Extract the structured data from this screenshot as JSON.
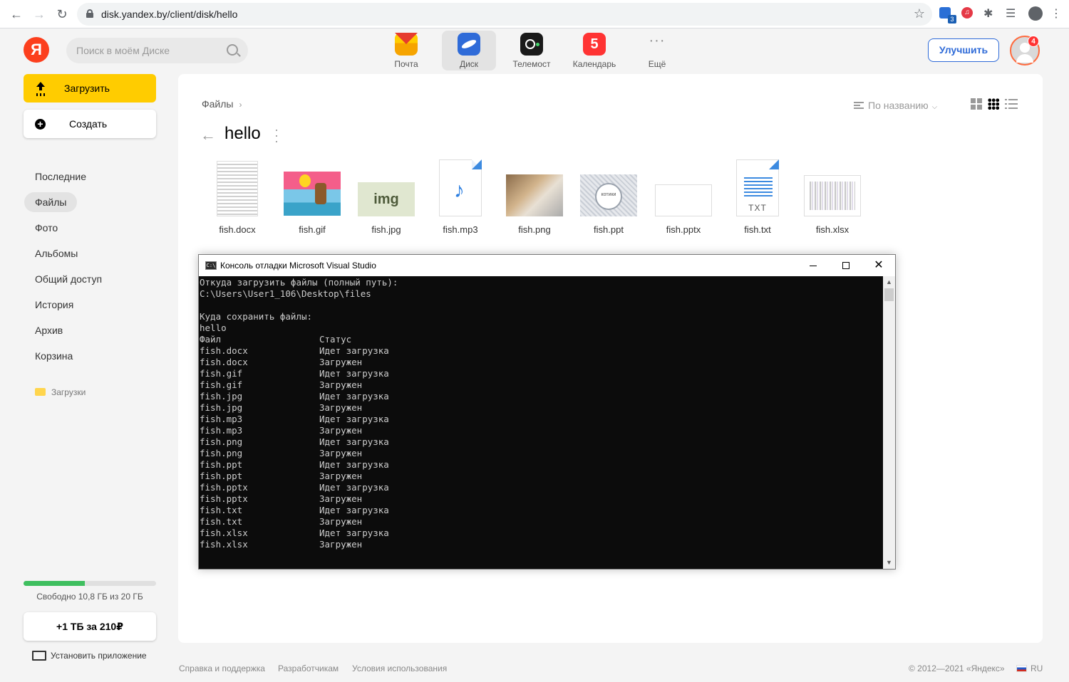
{
  "browser": {
    "url": "disk.yandex.by/client/disk/hello",
    "extension_badge": "3"
  },
  "header": {
    "logo": "Я",
    "search_placeholder": "Поиск в моём Диске",
    "apps": [
      {
        "label": "Почта",
        "icon": "mail-icon"
      },
      {
        "label": "Диск",
        "icon": "disk-icon",
        "active": true
      },
      {
        "label": "Телемост",
        "icon": "telemost-icon"
      },
      {
        "label": "Календарь",
        "icon": "calendar-icon",
        "day": "5"
      },
      {
        "label": "Ещё",
        "icon": "more-icon"
      }
    ],
    "upgrade_label": "Улучшить",
    "notification_count": "4"
  },
  "sidebar": {
    "upload_label": "Загрузить",
    "create_label": "Создать",
    "items": [
      {
        "label": "Последние"
      },
      {
        "label": "Файлы",
        "active": true
      },
      {
        "label": "Фото"
      },
      {
        "label": "Альбомы"
      },
      {
        "label": "Общий доступ"
      },
      {
        "label": "История"
      },
      {
        "label": "Архив"
      },
      {
        "label": "Корзина"
      }
    ],
    "folder_label": "Загрузки",
    "storage_text": "Свободно 10,8 ГБ из 20 ГБ",
    "storage_used_fraction": 0.46,
    "buy_label": "+1 ТБ за 210₽",
    "install_label": "Установить приложение"
  },
  "main": {
    "breadcrumb": "Файлы",
    "sort_label": "По названию",
    "folder_title": "hello",
    "files": [
      {
        "name": "fish.docx",
        "thumb": "docx"
      },
      {
        "name": "fish.gif",
        "thumb": "gif"
      },
      {
        "name": "fish.jpg",
        "thumb": "jpg",
        "thumb_text": "img"
      },
      {
        "name": "fish.mp3",
        "thumb": "mp3"
      },
      {
        "name": "fish.png",
        "thumb": "png"
      },
      {
        "name": "fish.ppt",
        "thumb": "ppt"
      },
      {
        "name": "fish.pptx",
        "thumb": "pptx"
      },
      {
        "name": "fish.txt",
        "thumb": "txt",
        "thumb_text": "TXT"
      },
      {
        "name": "fish.xlsx",
        "thumb": "xlsx"
      }
    ]
  },
  "console": {
    "icon_text": "C:\\",
    "title": "Консоль отладки Microsoft Visual Studio",
    "intro_lines": [
      "Откуда загрузить файлы (полный путь):",
      "C:\\Users\\User1_106\\Desktop\\files",
      "",
      "Куда сохранить файлы:",
      "hello"
    ],
    "table_header": {
      "file": "Файл",
      "status": "Статус"
    },
    "rows": [
      {
        "file": "fish.docx",
        "status": "Идет загрузка"
      },
      {
        "file": "fish.docx",
        "status": "Загружен"
      },
      {
        "file": "fish.gif",
        "status": "Идет загрузка"
      },
      {
        "file": "fish.gif",
        "status": "Загружен"
      },
      {
        "file": "fish.jpg",
        "status": "Идет загрузка"
      },
      {
        "file": "fish.jpg",
        "status": "Загружен"
      },
      {
        "file": "fish.mp3",
        "status": "Идет загрузка"
      },
      {
        "file": "fish.mp3",
        "status": "Загружен"
      },
      {
        "file": "fish.png",
        "status": "Идет загрузка"
      },
      {
        "file": "fish.png",
        "status": "Загружен"
      },
      {
        "file": "fish.ppt",
        "status": "Идет загрузка"
      },
      {
        "file": "fish.ppt",
        "status": "Загружен"
      },
      {
        "file": "fish.pptx",
        "status": "Идет загрузка"
      },
      {
        "file": "fish.pptx",
        "status": "Загружен"
      },
      {
        "file": "fish.txt",
        "status": "Идет загрузка"
      },
      {
        "file": "fish.txt",
        "status": "Загружен"
      },
      {
        "file": "fish.xlsx",
        "status": "Идет загрузка"
      },
      {
        "file": "fish.xlsx",
        "status": "Загружен"
      }
    ]
  },
  "footer": {
    "links": [
      "Справка и поддержка",
      "Разработчикам",
      "Условия использования"
    ],
    "copyright": "© 2012—2021 «Яндекс»",
    "lang": "RU"
  }
}
